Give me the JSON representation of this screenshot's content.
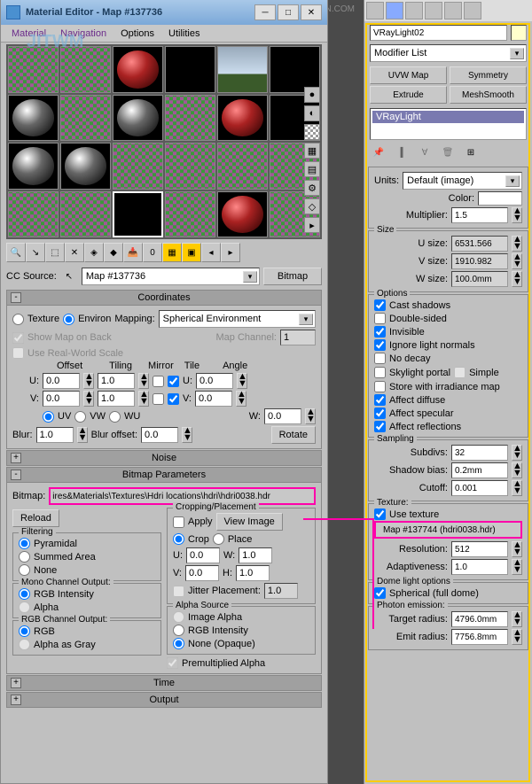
{
  "watermark": "思缘设计论坛 WWW.MISSYUAN.COM",
  "window": {
    "title": "Material Editor - Map #137736",
    "menus": {
      "material": "Material",
      "navigation": "Navigation",
      "options": "Options",
      "utilities": "Utilities"
    }
  },
  "cc": {
    "label": "CC Source:",
    "map": "Map #137736",
    "bitmap_btn": "Bitmap"
  },
  "rollouts": {
    "coordinates": {
      "title": "Coordinates",
      "texture": "Texture",
      "environ": "Environ",
      "mapping": "Mapping:",
      "mapping_val": "Spherical Environment",
      "show_map": "Show Map on Back",
      "map_channel": "Map Channel:",
      "map_channel_val": "1",
      "real_world": "Use Real-World Scale",
      "offset": "Offset",
      "tiling": "Tiling",
      "mirror": "Mirror",
      "tile": "Tile",
      "angle": "Angle",
      "u": "U:",
      "v": "V:",
      "w": "W:",
      "u_off": "0.0",
      "u_tile": "1.0",
      "u_ang": "0.0",
      "v_off": "0.0",
      "v_tile": "1.0",
      "v_ang": "0.0",
      "w_ang": "0.0",
      "uv": "UV",
      "vw": "VW",
      "wu": "WU",
      "blur": "Blur:",
      "blur_val": "1.0",
      "blur_off": "Blur offset:",
      "blur_off_val": "0.0",
      "rotate": "Rotate"
    },
    "noise": {
      "title": "Noise"
    },
    "bitmap_params": {
      "title": "Bitmap Parameters",
      "bitmap_lbl": "Bitmap:",
      "bitmap_path": "ires&Materials\\Textures\\Hdri locations\\hdri\\hdri0038.hdr",
      "reload": "Reload",
      "filtering": "Filtering",
      "pyramidal": "Pyramidal",
      "summed": "Summed Area",
      "none": "None",
      "mono": "Mono Channel Output:",
      "rgb_int": "RGB Intensity",
      "alpha": "Alpha",
      "rgb_out": "RGB Channel Output:",
      "rgb": "RGB",
      "alpha_gray": "Alpha as Gray",
      "crop": "Cropping/Placement",
      "apply": "Apply",
      "view": "View Image",
      "crop_r": "Crop",
      "place": "Place",
      "cu": "U:",
      "cv": "V:",
      "cw": "W:",
      "ch": "H:",
      "cu_v": "0.0",
      "cv_v": "0.0",
      "cw_v": "1.0",
      "ch_v": "1.0",
      "jitter": "Jitter Placement:",
      "jitter_v": "1.0",
      "alpha_src": "Alpha Source",
      "img_alpha": "Image Alpha",
      "none_op": "None (Opaque)",
      "premult": "Premultiplied Alpha"
    },
    "time": {
      "title": "Time"
    },
    "output": {
      "title": "Output"
    }
  },
  "panel": {
    "obj_name": "VRayLight02",
    "modifier_list": "Modifier List",
    "buttons": {
      "uvw": "UVW Map",
      "sym": "Symmetry",
      "extrude": "Extrude",
      "mesh": "MeshSmooth"
    },
    "modifier_stack": "VRayLight",
    "units": "Units:",
    "units_val": "Default (image)",
    "color": "Color:",
    "multiplier": "Multiplier:",
    "multiplier_val": "1.5",
    "size": "Size",
    "u_size": "U size:",
    "u_size_v": "6531.566",
    "v_size": "V size:",
    "v_size_v": "1910.982",
    "w_size": "W size:",
    "w_size_v": "100.0mm",
    "options": "Options",
    "cast": "Cast shadows",
    "double": "Double-sided",
    "invisible": "Invisible",
    "ignore": "Ignore light normals",
    "decay": "No decay",
    "skylight": "Skylight portal",
    "simple": "Simple",
    "irr": "Store with irradiance map",
    "diff": "Affect diffuse",
    "spec": "Affect specular",
    "refl": "Affect reflections",
    "sampling": "Sampling",
    "subdivs": "Subdivs:",
    "subdivs_v": "32",
    "bias": "Shadow bias:",
    "bias_v": "0.2mm",
    "cutoff": "Cutoff:",
    "cutoff_v": "0.001",
    "texture": "Texture:",
    "use_tex": "Use texture",
    "tex_map": "Map #137744 (hdri0038.hdr)",
    "resolution": "Resolution:",
    "resolution_v": "512",
    "adapt": "Adaptiveness:",
    "adapt_v": "1.0",
    "dome": "Dome light options",
    "spherical": "Spherical (full dome)",
    "photon": "Photon emission:",
    "target": "Target radius:",
    "target_v": "4796.0mm",
    "emit": "Emit radius:",
    "emit_v": "7756.8mm"
  }
}
